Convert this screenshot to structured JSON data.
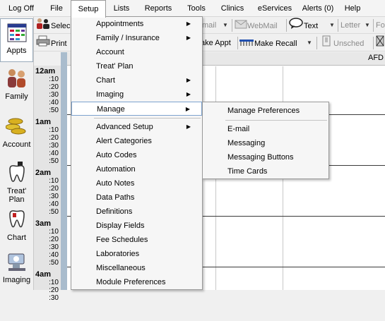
{
  "menubar": {
    "items": [
      {
        "label": "Log Off"
      },
      {
        "label": "File"
      },
      {
        "label": "Setup"
      },
      {
        "label": "Lists"
      },
      {
        "label": "Reports"
      },
      {
        "label": "Tools"
      },
      {
        "label": "Clinics"
      },
      {
        "label": "eServices"
      },
      {
        "label": "Alerts (0)"
      },
      {
        "label": "Help"
      }
    ]
  },
  "toolbar1": {
    "select_label": "Selec",
    "email_label": "mail",
    "webmail_label": "WebMail",
    "text_label": "Text",
    "letter_label": "Letter",
    "fo_label": "Fo"
  },
  "toolbar2": {
    "print_label": "Print",
    "make_appt_label": "ake Appt",
    "make_recall_label": "Make Recall",
    "unsched_label": "Unsched"
  },
  "leftnav": {
    "items": [
      {
        "label": "Appts",
        "icon": "calendar-icon"
      },
      {
        "label": "Family",
        "icon": "people-icon"
      },
      {
        "label": "Account",
        "icon": "coins-icon"
      },
      {
        "label": "Treat' Plan",
        "icon": "tooth-icon"
      },
      {
        "label": "Chart",
        "icon": "tooth-chart-icon"
      },
      {
        "label": "Imaging",
        "icon": "xray-icon"
      }
    ]
  },
  "schedule": {
    "provider_header": "AFD",
    "hours": [
      {
        "label": "12am",
        "mins": [
          ":10",
          ":20",
          ":30",
          ":40",
          ":50"
        ]
      },
      {
        "label": "1am",
        "mins": [
          ":10",
          ":20",
          ":30",
          ":40",
          ":50"
        ]
      },
      {
        "label": "2am",
        "mins": [
          ":10",
          ":20",
          ":30",
          ":40",
          ":50"
        ]
      },
      {
        "label": "3am",
        "mins": [
          ":10",
          ":20",
          ":30",
          ":40",
          ":50"
        ]
      },
      {
        "label": "4am",
        "mins": [
          ":10",
          ":20",
          ":30"
        ]
      }
    ]
  },
  "setup_menu": {
    "items": [
      {
        "label": "Appointments",
        "submenu": true
      },
      {
        "label": "Family / Insurance",
        "submenu": true
      },
      {
        "label": "Account",
        "submenu": false
      },
      {
        "label": "Treat' Plan",
        "submenu": false
      },
      {
        "label": "Chart",
        "submenu": true
      },
      {
        "label": "Imaging",
        "submenu": true
      },
      {
        "label": "Manage",
        "submenu": true
      },
      {
        "label": "Advanced Setup",
        "submenu": true
      },
      {
        "label": "Alert Categories",
        "submenu": false
      },
      {
        "label": "Auto Codes",
        "submenu": false
      },
      {
        "label": "Automation",
        "submenu": false
      },
      {
        "label": "Auto Notes",
        "submenu": false
      },
      {
        "label": "Data Paths",
        "submenu": false
      },
      {
        "label": "Definitions",
        "submenu": false
      },
      {
        "label": "Display Fields",
        "submenu": false
      },
      {
        "label": "Fee Schedules",
        "submenu": false
      },
      {
        "label": "Laboratories",
        "submenu": false
      },
      {
        "label": "Miscellaneous",
        "submenu": false
      },
      {
        "label": "Module Preferences",
        "submenu": false
      }
    ]
  },
  "manage_submenu": {
    "items": [
      {
        "label": "Manage Preferences"
      },
      {
        "label": "E-mail"
      },
      {
        "label": "Messaging"
      },
      {
        "label": "Messaging Buttons"
      },
      {
        "label": "Time Cards"
      }
    ]
  },
  "colors": {
    "highlight_border": "#7da2ce",
    "time_stripe": "#a9bccd"
  }
}
